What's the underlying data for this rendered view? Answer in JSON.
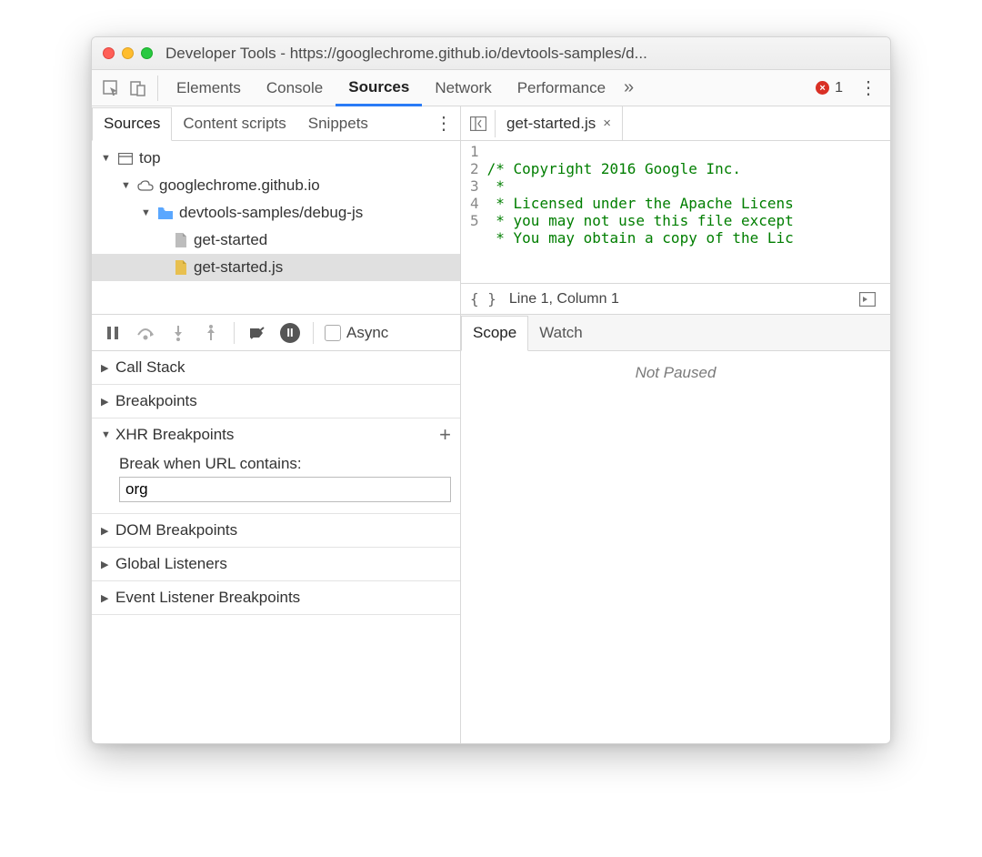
{
  "window": {
    "title": "Developer Tools - https://googlechrome.github.io/devtools-samples/d..."
  },
  "main_tabs": {
    "items": [
      "Elements",
      "Console",
      "Sources",
      "Network",
      "Performance"
    ],
    "active_index": 2,
    "overflow_glyph": "»",
    "error_count": "1"
  },
  "sources_panel": {
    "subtabs": [
      "Sources",
      "Content scripts",
      "Snippets"
    ],
    "active_index": 0
  },
  "file_tree": {
    "top": "top",
    "domain": "googlechrome.github.io",
    "folder": "devtools-samples/debug-js",
    "files": [
      "get-started",
      "get-started.js"
    ],
    "selected_index": 1
  },
  "editor": {
    "open_tab": "get-started.js",
    "gutter": [
      "1",
      "2",
      "3",
      "4",
      "5"
    ],
    "lines": [
      "/* Copyright 2016 Google Inc.",
      " *",
      " * Licensed under the Apache Licens",
      " * you may not use this file except",
      " * You may obtain a copy of the Lic"
    ],
    "status": "Line 1, Column 1",
    "braces": "{ }"
  },
  "debugger": {
    "async_label": "Async",
    "sections": {
      "call_stack": "Call Stack",
      "breakpoints": "Breakpoints",
      "xhr": "XHR Breakpoints",
      "xhr_label": "Break when URL contains:",
      "xhr_value": "org",
      "dom": "DOM Breakpoints",
      "global": "Global Listeners",
      "event": "Event Listener Breakpoints"
    }
  },
  "scope_watch": {
    "tabs": [
      "Scope",
      "Watch"
    ],
    "active_index": 0,
    "body": "Not Paused"
  }
}
